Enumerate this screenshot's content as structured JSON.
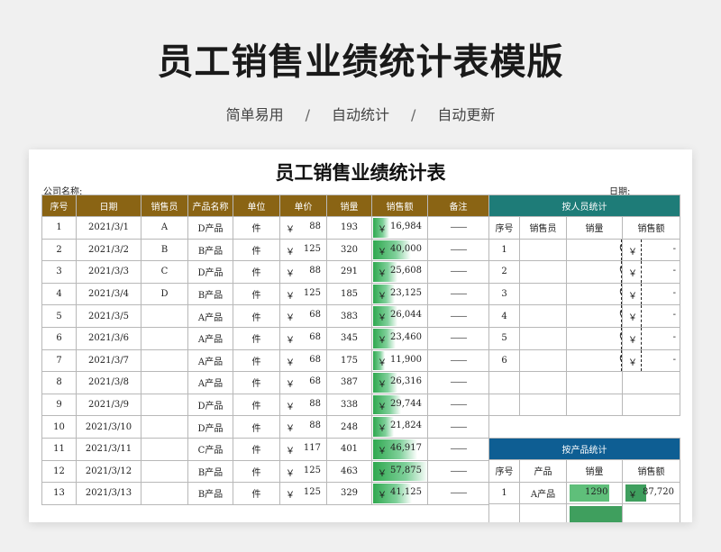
{
  "header": {
    "title": "员工销售业绩统计表模版",
    "tags": [
      "简单易用",
      "自动统计",
      "自动更新"
    ],
    "separator": "/"
  },
  "sheet": {
    "title": "员工销售业绩统计表",
    "company_label": "公司名称:",
    "date_label": "日期:",
    "columns": [
      "序号",
      "日期",
      "销售员",
      "产品名称",
      "单位",
      "单价",
      "销量",
      "销售额",
      "备注"
    ],
    "currency": "￥",
    "rows": [
      {
        "no": "1",
        "date": "2021/3/1",
        "seller": "A",
        "product": "D产品",
        "unit": "件",
        "price": "88",
        "qty": "193",
        "sales": "16,984",
        "sales_value": 16984,
        "note": "——"
      },
      {
        "no": "2",
        "date": "2021/3/2",
        "seller": "B",
        "product": "B产品",
        "unit": "件",
        "price": "125",
        "qty": "320",
        "sales": "40,000",
        "sales_value": 40000,
        "note": "——"
      },
      {
        "no": "3",
        "date": "2021/3/3",
        "seller": "C",
        "product": "D产品",
        "unit": "件",
        "price": "88",
        "qty": "291",
        "sales": "25,608",
        "sales_value": 25608,
        "note": "——"
      },
      {
        "no": "4",
        "date": "2021/3/4",
        "seller": "D",
        "product": "B产品",
        "unit": "件",
        "price": "125",
        "qty": "185",
        "sales": "23,125",
        "sales_value": 23125,
        "note": "——"
      },
      {
        "no": "5",
        "date": "2021/3/5",
        "seller": "",
        "product": "A产品",
        "unit": "件",
        "price": "68",
        "qty": "383",
        "sales": "26,044",
        "sales_value": 26044,
        "note": "——"
      },
      {
        "no": "6",
        "date": "2021/3/6",
        "seller": "",
        "product": "A产品",
        "unit": "件",
        "price": "68",
        "qty": "345",
        "sales": "23,460",
        "sales_value": 23460,
        "note": "——"
      },
      {
        "no": "7",
        "date": "2021/3/7",
        "seller": "",
        "product": "A产品",
        "unit": "件",
        "price": "68",
        "qty": "175",
        "sales": "11,900",
        "sales_value": 11900,
        "note": "——"
      },
      {
        "no": "8",
        "date": "2021/3/8",
        "seller": "",
        "product": "A产品",
        "unit": "件",
        "price": "68",
        "qty": "387",
        "sales": "26,316",
        "sales_value": 26316,
        "note": "——"
      },
      {
        "no": "9",
        "date": "2021/3/9",
        "seller": "",
        "product": "D产品",
        "unit": "件",
        "price": "88",
        "qty": "338",
        "sales": "29,744",
        "sales_value": 29744,
        "note": "——"
      },
      {
        "no": "10",
        "date": "2021/3/10",
        "seller": "",
        "product": "D产品",
        "unit": "件",
        "price": "88",
        "qty": "248",
        "sales": "21,824",
        "sales_value": 21824,
        "note": "——"
      },
      {
        "no": "11",
        "date": "2021/3/11",
        "seller": "",
        "product": "C产品",
        "unit": "件",
        "price": "117",
        "qty": "401",
        "sales": "46,917",
        "sales_value": 46917,
        "note": "——"
      },
      {
        "no": "12",
        "date": "2021/3/12",
        "seller": "",
        "product": "B产品",
        "unit": "件",
        "price": "125",
        "qty": "463",
        "sales": "57,875",
        "sales_value": 57875,
        "note": "——"
      },
      {
        "no": "13",
        "date": "2021/3/13",
        "seller": "",
        "product": "B产品",
        "unit": "件",
        "price": "125",
        "qty": "329",
        "sales": "41,125",
        "sales_value": 41125,
        "note": "——"
      }
    ],
    "sales_max": 57875
  },
  "by_person": {
    "title": "按人员统计",
    "columns": [
      "序号",
      "销售员",
      "销量",
      "销售额"
    ],
    "zero": "0",
    "dash": "-",
    "currency": "￥",
    "rows": [
      "1",
      "2",
      "3",
      "4",
      "5",
      "6"
    ]
  },
  "by_product": {
    "title": "按产品统计",
    "columns": [
      "序号",
      "产品",
      "销量",
      "销售额"
    ],
    "currency": "￥",
    "rows": [
      {
        "no": "1",
        "product": "A产品",
        "qty": "1290",
        "sales": "87,720",
        "qty_fraction": 0.72
      }
    ]
  },
  "colors": {
    "main_header": "#8a6414",
    "person_header": "#1e7c78",
    "product_header": "#0e5e93",
    "sales_bar": "#2fa84f"
  }
}
